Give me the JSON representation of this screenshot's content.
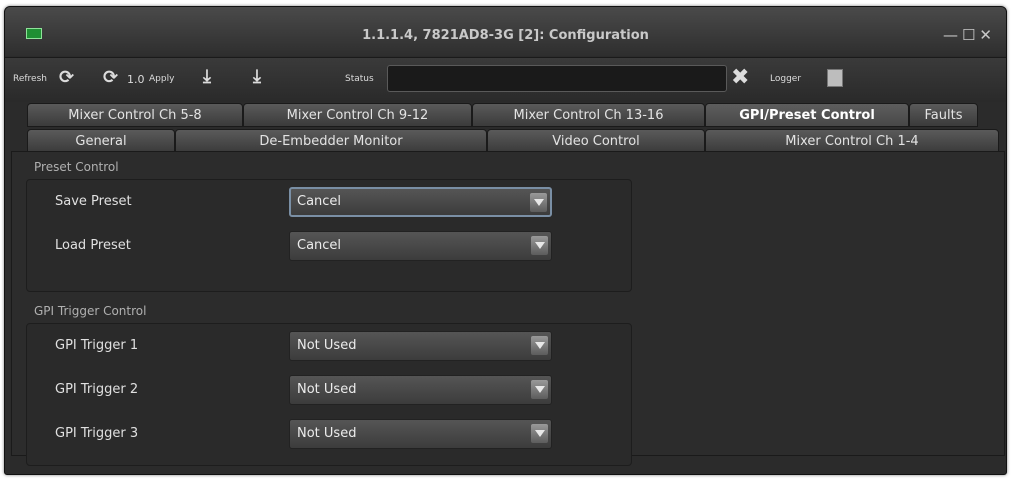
{
  "window": {
    "title": "1.1.1.4, 7821AD8-3G  [2]: Configuration",
    "icon": "device-icon",
    "controls": [
      "minimize-icon",
      "maximize-icon",
      "close-icon"
    ]
  },
  "toolbar": {
    "refresh_label": "Refresh",
    "refresh_icon": "refresh-icon",
    "auto_refresh_icon": "sync-icon",
    "version_label": "1.0",
    "apply_label": "Apply",
    "download_icon": "download-icon",
    "download_all_icon": "download-all-icon",
    "status_label": "Status",
    "status_value": "",
    "clear_icon": "close-icon",
    "logger_label": "Logger",
    "logger_icon": "logger-icon"
  },
  "tabs": {
    "row1": [
      "Mixer Control Ch 5-8",
      "Mixer Control Ch 9-12",
      "Mixer Control Ch 13-16",
      "GPI/Preset Control",
      "Faults"
    ],
    "row2": [
      "General",
      "De-Embedder Monitor",
      "Video Control",
      "Mixer Control Ch 1-4"
    ],
    "active": "GPI/Preset Control"
  },
  "preset_section": {
    "title": "Preset Control",
    "rows": [
      {
        "label": "Save Preset",
        "value": "Cancel"
      },
      {
        "label": "Load Preset",
        "value": "Cancel"
      }
    ]
  },
  "gpi_section": {
    "title": "GPI Trigger Control",
    "rows": [
      {
        "label": "GPI Trigger 1",
        "value": "Not Used"
      },
      {
        "label": "GPI Trigger 2",
        "value": "Not Used"
      },
      {
        "label": "GPI Trigger 3",
        "value": "Not Used"
      }
    ]
  },
  "colors": {
    "window_bg": "#2b2b2b",
    "focus_border": "#7a8fa5",
    "icon_green": "#1f8f33"
  }
}
